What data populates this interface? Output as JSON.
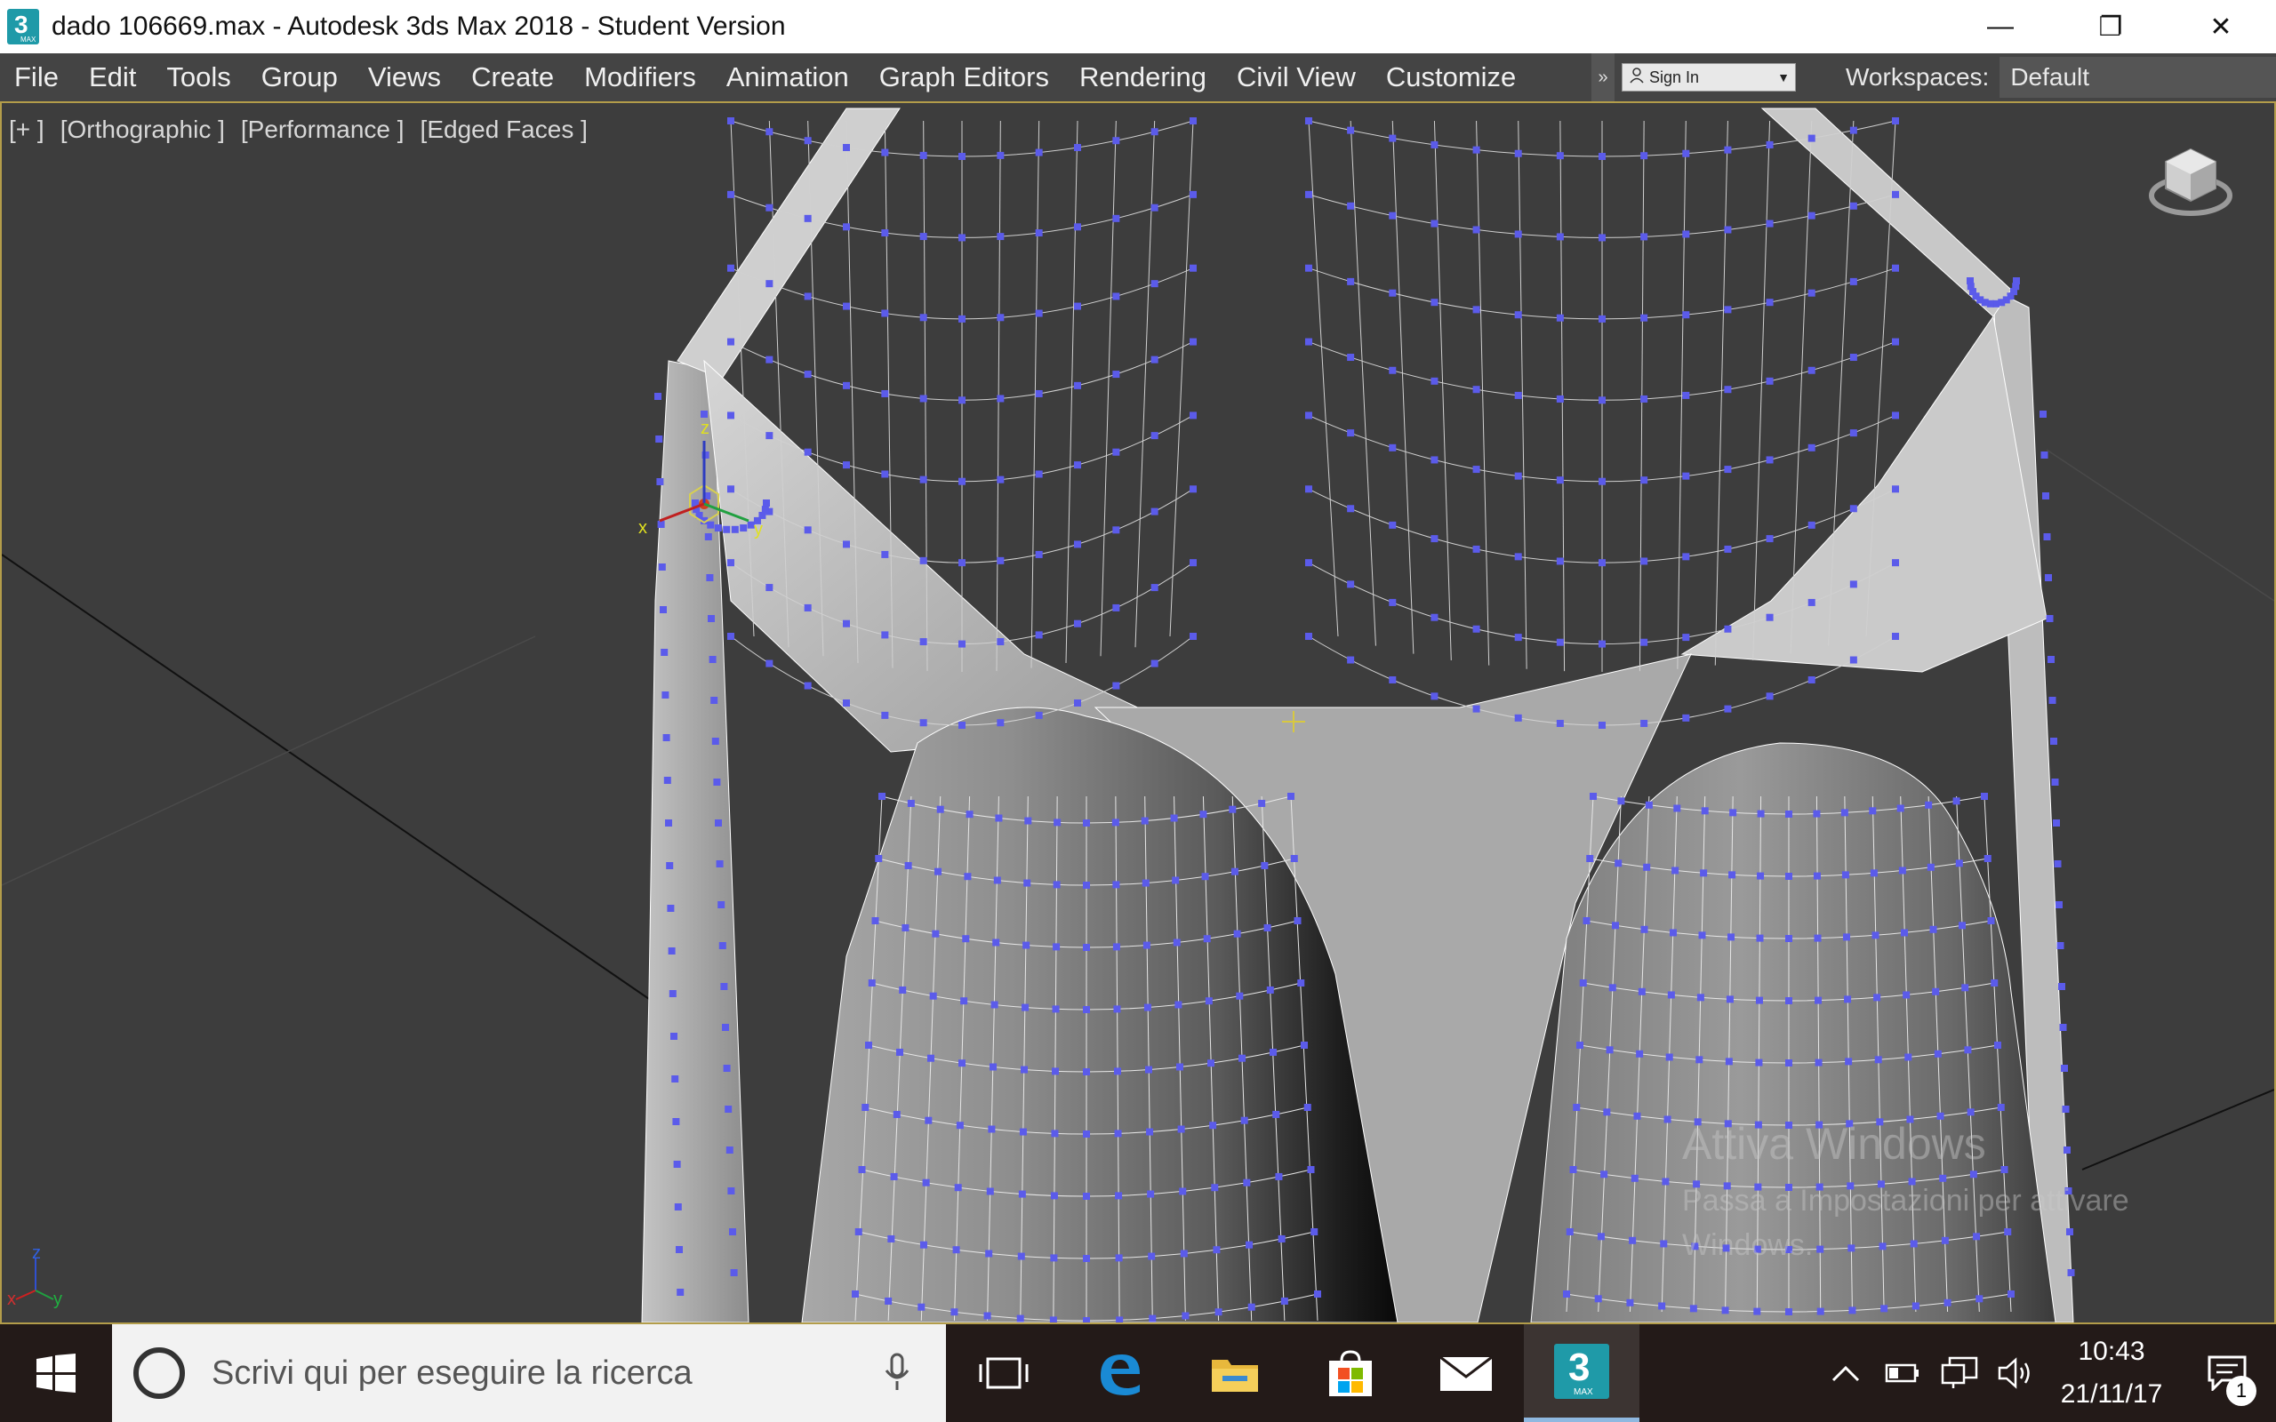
{
  "window": {
    "title": "dado 106669.max - Autodesk 3ds Max 2018 - Student Version",
    "app_icon_text": "3",
    "app_icon_sub": "MAX",
    "minimize": "—",
    "restore": "❐",
    "close": "✕"
  },
  "menu": {
    "items": [
      "File",
      "Edit",
      "Tools",
      "Group",
      "Views",
      "Create",
      "Modifiers",
      "Animation",
      "Graph Editors",
      "Rendering",
      "Civil View",
      "Customize"
    ],
    "overflow": "»",
    "signin": "Sign In",
    "workspaces_label": "Workspaces:",
    "workspace_value": "Default"
  },
  "viewport": {
    "labels": [
      "[+ ]",
      "[Orthographic ]",
      "[Performance ]",
      "[Edged Faces ]"
    ],
    "gizmo": {
      "x": "x",
      "y": "y",
      "z": "z"
    },
    "axis_tripod": {
      "x": "x",
      "y": "y",
      "z": "z"
    },
    "watermark_title": "Attiva Windows",
    "watermark_text": "Passa a Impostazioni per attivare Windows."
  },
  "taskbar": {
    "search_placeholder": "Scrivi qui per eseguire la ricerca",
    "time": "10:43",
    "date": "21/11/17",
    "notification_count": "1",
    "max_icon_text": "3",
    "max_icon_sub": "MAX"
  },
  "colors": {
    "menu_bg": "#444444",
    "viewport_bg": "#3d3d3d",
    "vertex": "#5b5bea",
    "viewport_border": "#b39d4a",
    "taskbar_bg": "#231a18"
  }
}
